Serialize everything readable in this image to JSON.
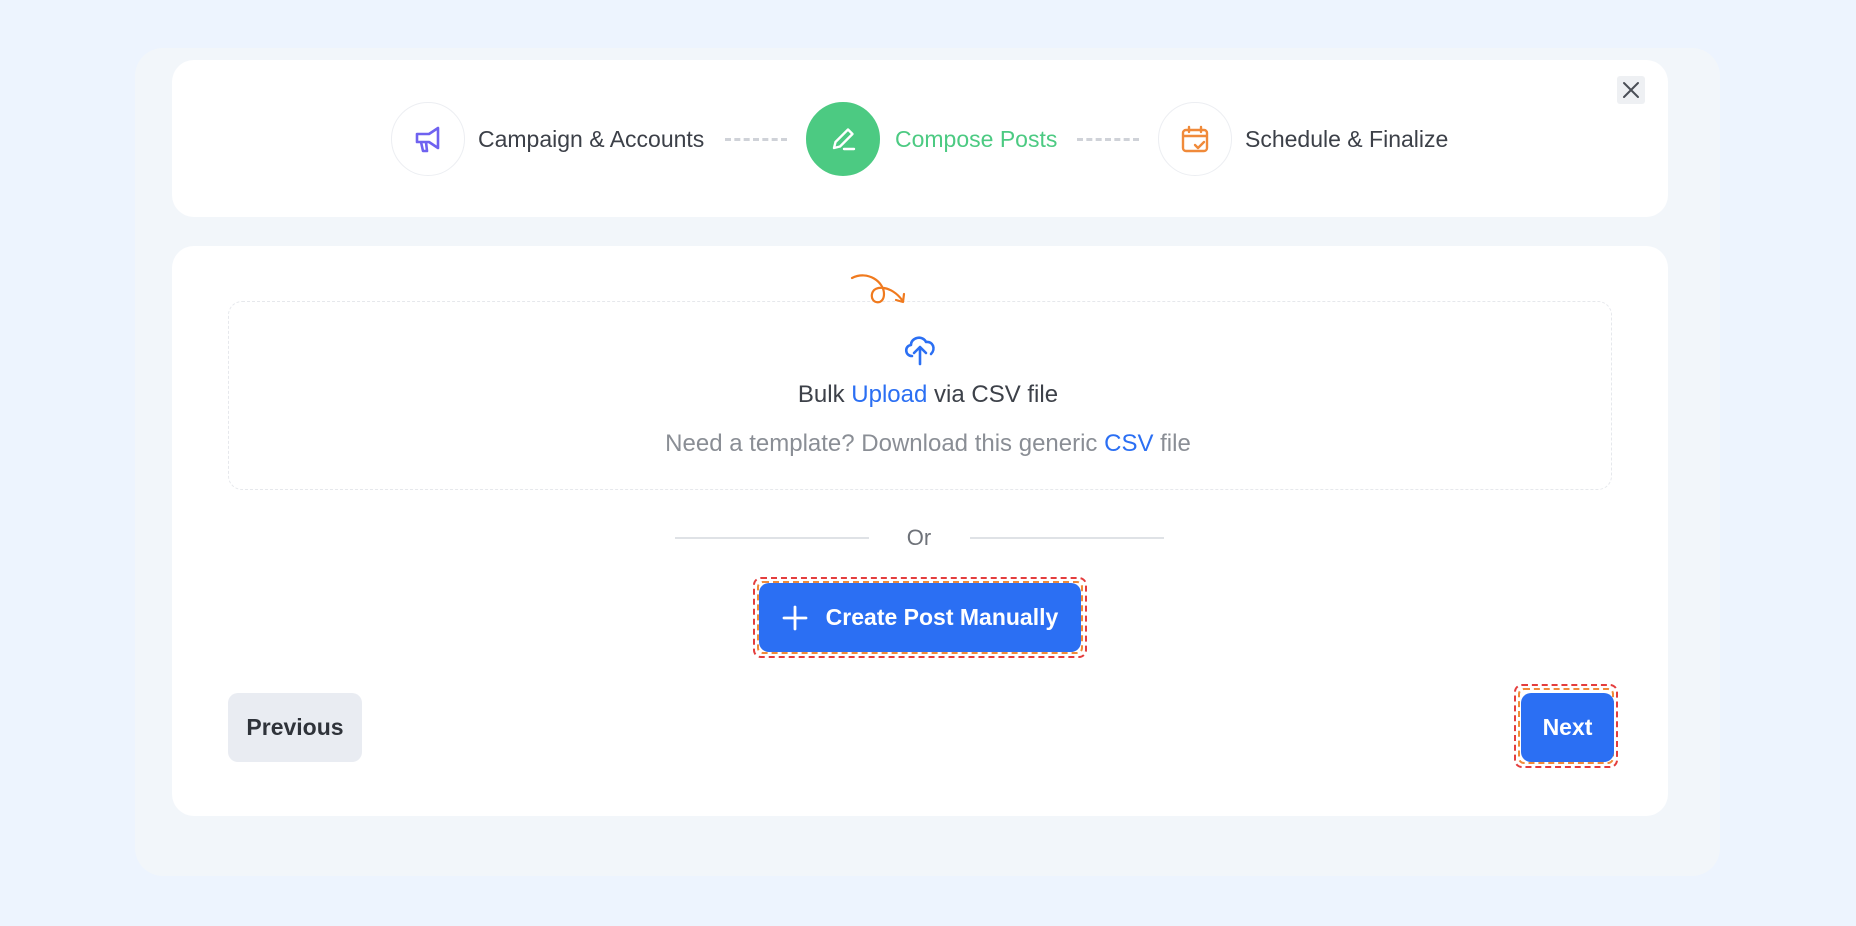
{
  "stepper": {
    "steps": [
      {
        "label": "Campaign & Accounts",
        "icon": "megaphone-icon",
        "state": "completed"
      },
      {
        "label": "Compose Posts",
        "icon": "pencil-icon",
        "state": "active"
      },
      {
        "label": "Schedule & Finalize",
        "icon": "calendar-check-icon",
        "state": "upcoming"
      }
    ]
  },
  "dialog": {
    "close_icon": "close-icon"
  },
  "upload": {
    "title_prefix": "Bulk",
    "title_link": "Upload",
    "title_suffix": "via CSV file",
    "subtitle_prefix": "Need a template? Download this generic",
    "subtitle_link": "CSV",
    "subtitle_suffix": "file",
    "icon": "cloud-upload-icon"
  },
  "divider": {
    "label": "Or"
  },
  "actions": {
    "create_label": "Create Post Manually",
    "previous_label": "Previous",
    "next_label": "Next"
  },
  "colors": {
    "primary": "#2b6ff3",
    "success": "#4cca82",
    "accent_orange": "#f08a3a",
    "megaphone_purple": "#6f62f0"
  }
}
